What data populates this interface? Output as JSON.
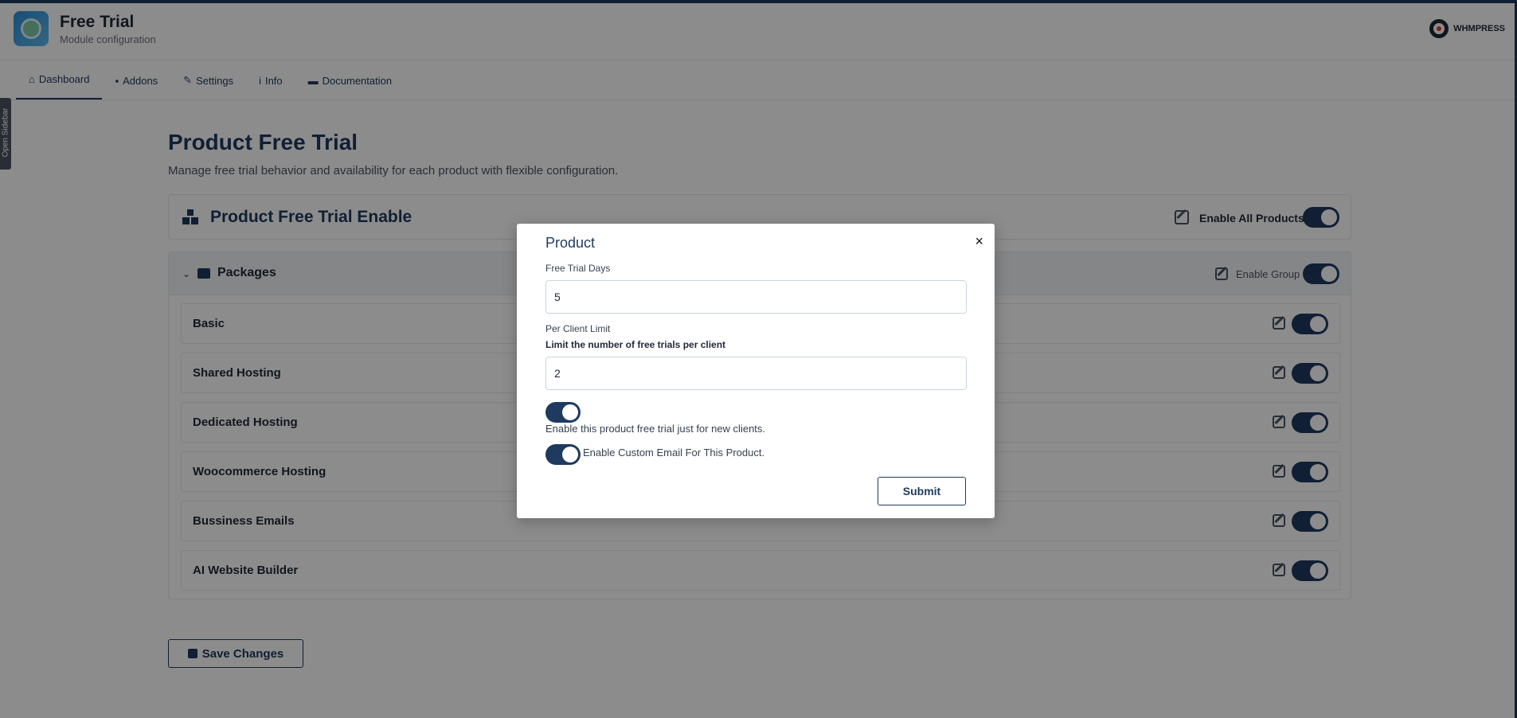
{
  "app": {
    "title": "Free Trial",
    "subtitle": "Module configuration",
    "brand": "WHMPRESS"
  },
  "tabs": [
    {
      "label": "Dashboard",
      "icon": "home-icon"
    },
    {
      "label": "Addons",
      "icon": "tag-icon"
    },
    {
      "label": "Settings",
      "icon": "wrench-icon"
    },
    {
      "label": "Info",
      "icon": "info-icon"
    },
    {
      "label": "Documentation",
      "icon": "folder-icon"
    }
  ],
  "sidebar": {
    "toggle_label": "Open Sidebar"
  },
  "page": {
    "title": "Product Free Trial",
    "description": "Manage free trial behavior and availability for each product with flexible configuration."
  },
  "enable_card": {
    "title": "Product Free Trial Enable",
    "enable_all_label": "Enable All Products"
  },
  "group": {
    "title": "Packages",
    "enable_label": "Enable Group",
    "packages": [
      {
        "name": "Basic"
      },
      {
        "name": "Shared Hosting"
      },
      {
        "name": "Dedicated Hosting"
      },
      {
        "name": "Woocommerce Hosting"
      },
      {
        "name": "Bussiness Emails"
      },
      {
        "name": "AI Website Builder"
      }
    ]
  },
  "save_label": "Save Changes",
  "modal": {
    "title": "Product",
    "close": "×",
    "free_trial_days_label": "Free Trial Days",
    "free_trial_days_value": "5",
    "per_client_label": "Per Client Limit",
    "per_client_help": "Limit the number of free trials per client",
    "per_client_value": "2",
    "new_clients_text": "Enable this product free trial just for new clients.",
    "custom_email_text": "Enable Custom Email For This Product.",
    "submit_label": "Submit"
  },
  "colors": {
    "accent": "#1e3a5f",
    "overlay": "rgba(0,0,0,0.45)"
  }
}
